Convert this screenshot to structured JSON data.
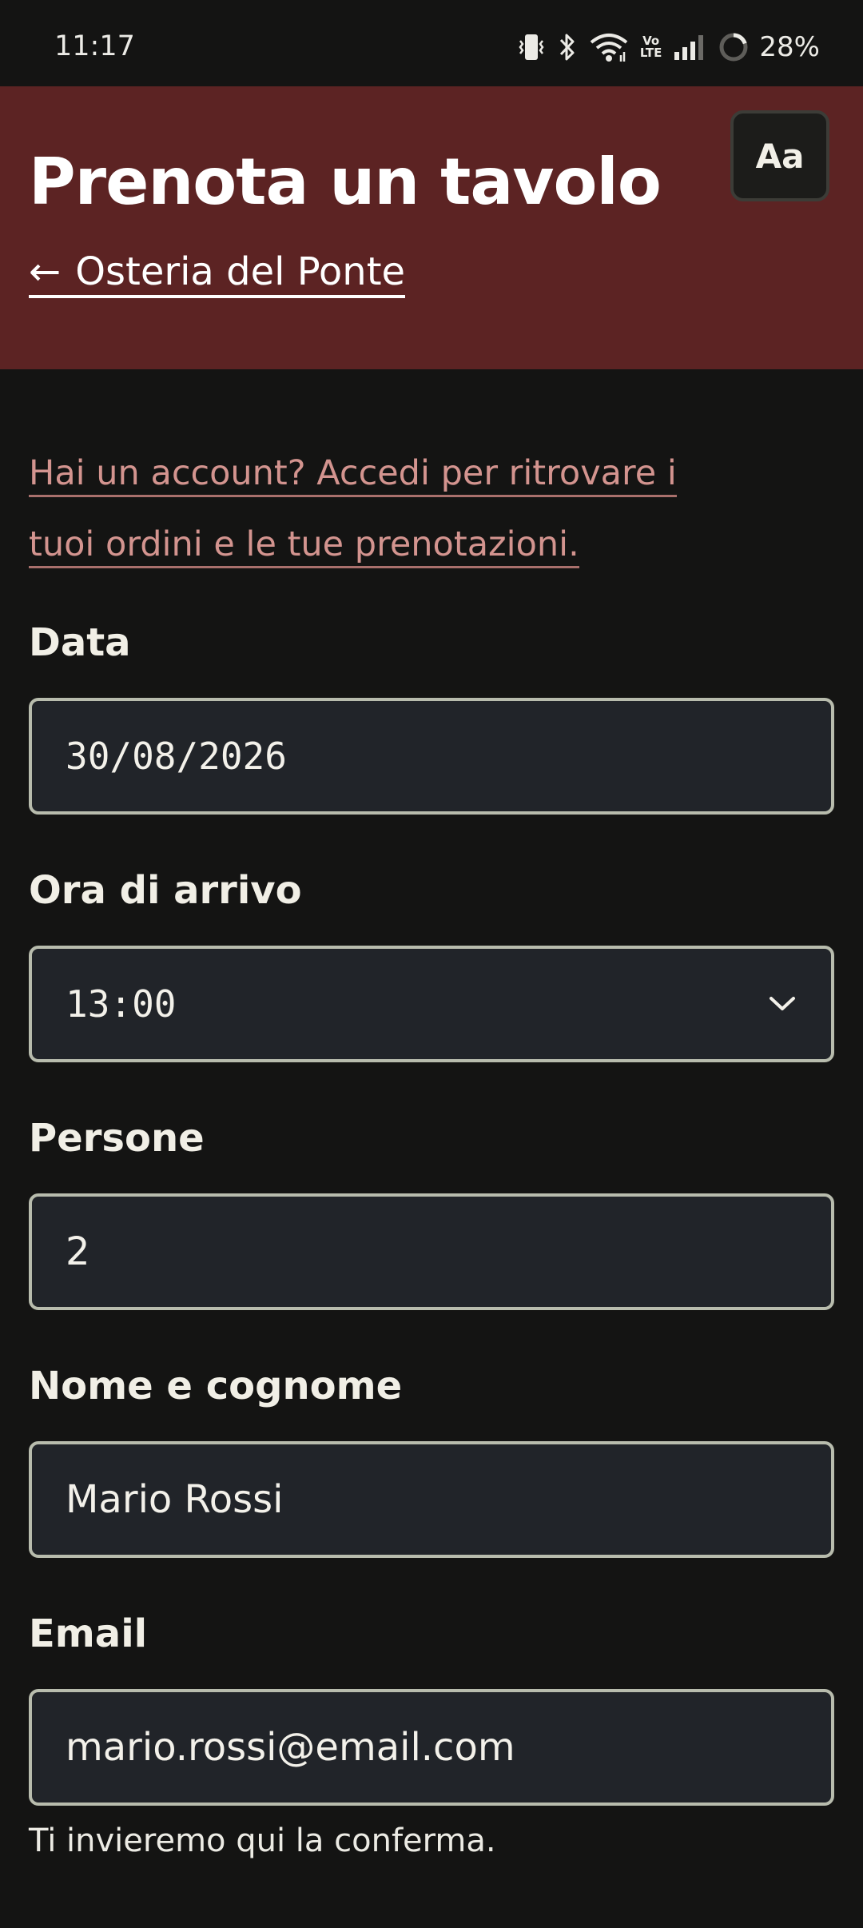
{
  "status_bar": {
    "time": "11:17",
    "battery": "28%",
    "icons": [
      "vibrate-icon",
      "bluetooth-icon",
      "wifi-icon",
      "volte-icon",
      "signal-icon",
      "battery-ring-icon"
    ],
    "volte_top": "Vo",
    "volte_bottom": "LTE"
  },
  "header": {
    "title": "Prenota un tavolo",
    "back_arrow": "←",
    "back_label": "Osteria del Ponte",
    "font_toggle_label": "Aa",
    "background": "#5c2323"
  },
  "login_prompt": "Hai un account? Accedi per ritrovare i tuoi ordini e le tue prenotazioni.",
  "form": {
    "date": {
      "label": "Data",
      "value": "30/08/2026"
    },
    "time": {
      "label": "Ora di arrivo",
      "value": "13:00"
    },
    "people": {
      "label": "Persone",
      "value": "2"
    },
    "name": {
      "label": "Nome e cognome",
      "value": "Mario Rossi"
    },
    "email": {
      "label": "Email",
      "value": "mario.rossi@email.com",
      "helper": "Ti invieremo qui la conferma."
    }
  },
  "colors": {
    "page_background": "#141413",
    "field_background": "#212429",
    "field_border": "#b8bcad",
    "link": "#d3948f"
  }
}
